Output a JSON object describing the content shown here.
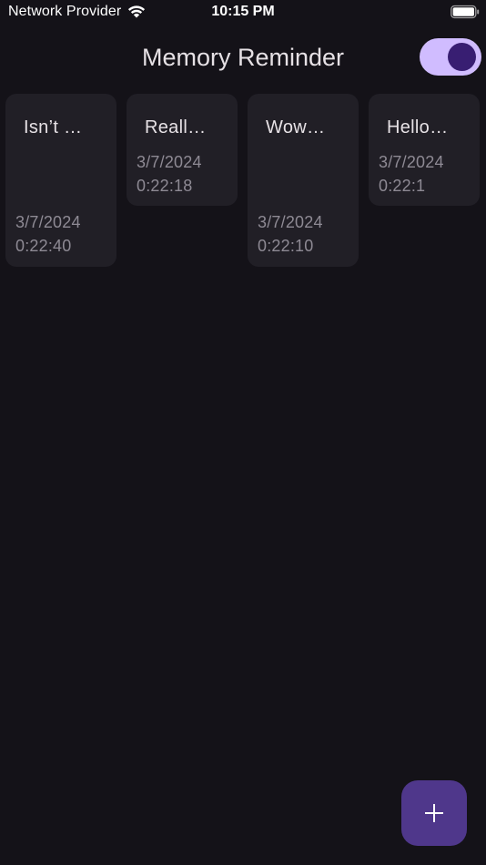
{
  "status_bar": {
    "carrier": "Network Provider",
    "time": "10:15 PM",
    "wifi_icon": "wifi-icon",
    "battery_icon": "battery-icon"
  },
  "app_bar": {
    "title": "Memory Reminder",
    "theme_toggle_on": true
  },
  "notes": [
    {
      "title": "Isn’t …",
      "date": "3/7/2024",
      "time": "0:22:40"
    },
    {
      "title": "Reall…",
      "date": "3/7/2024",
      "time": "0:22:18"
    },
    {
      "title": "Wow…",
      "date": "3/7/2024",
      "time": "0:22:10"
    },
    {
      "title": "Hello…",
      "date": "3/7/2024",
      "time": "0:22:1"
    }
  ],
  "fab": {
    "icon": "plus-icon"
  },
  "colors": {
    "background": "#141218",
    "card": "#211f26",
    "switch_track": "#d0bcff",
    "switch_thumb": "#381e72",
    "fab": "#4f378b"
  }
}
